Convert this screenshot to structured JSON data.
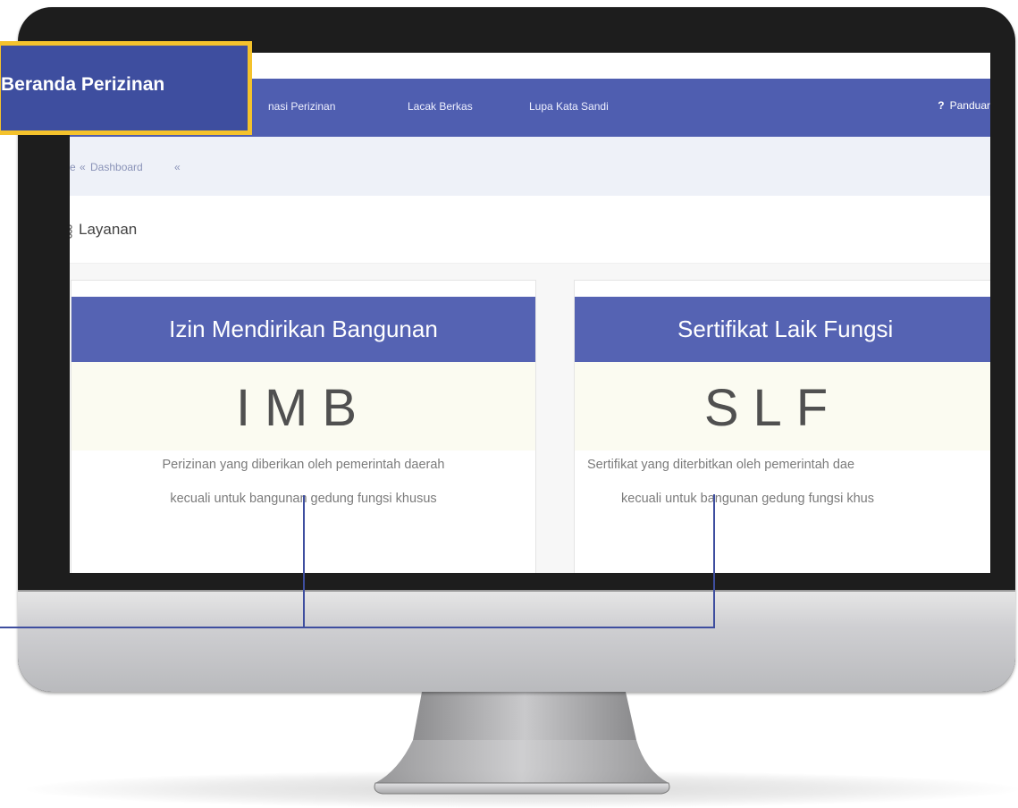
{
  "callout": {
    "label": "Beranda Perizinan"
  },
  "navbar": {
    "items": [
      "nasi Perizinan",
      "Lacak Berkas",
      "Lupa Kata Sandi"
    ],
    "help_icon": "?",
    "help_label": "Panduar"
  },
  "breadcrumb": {
    "items": [
      "e",
      "Dashboard"
    ],
    "separator": "«"
  },
  "section": {
    "icon": "grid-dots-icon",
    "title": "Layanan"
  },
  "cards": [
    {
      "title": "Izin Mendirikan Bangunan",
      "code": "IMB",
      "desc_line1": "Perizinan yang diberikan oleh pemerintah daerah",
      "desc_line2": "kecuali untuk bangunan gedung fungsi khusus"
    },
    {
      "title": "Sertifikat Laik Fungsi",
      "code": "SLF",
      "desc_line1": "Sertifikat yang diterbitkan oleh pemerintah dae",
      "desc_line2": "kecuali untuk bangunan gedung fungsi khus"
    }
  ],
  "colors": {
    "navbar": "#4f5eb0",
    "card_header": "#5563b3",
    "callout_fill": "#3e4e9f",
    "callout_border": "#f4c22c"
  }
}
